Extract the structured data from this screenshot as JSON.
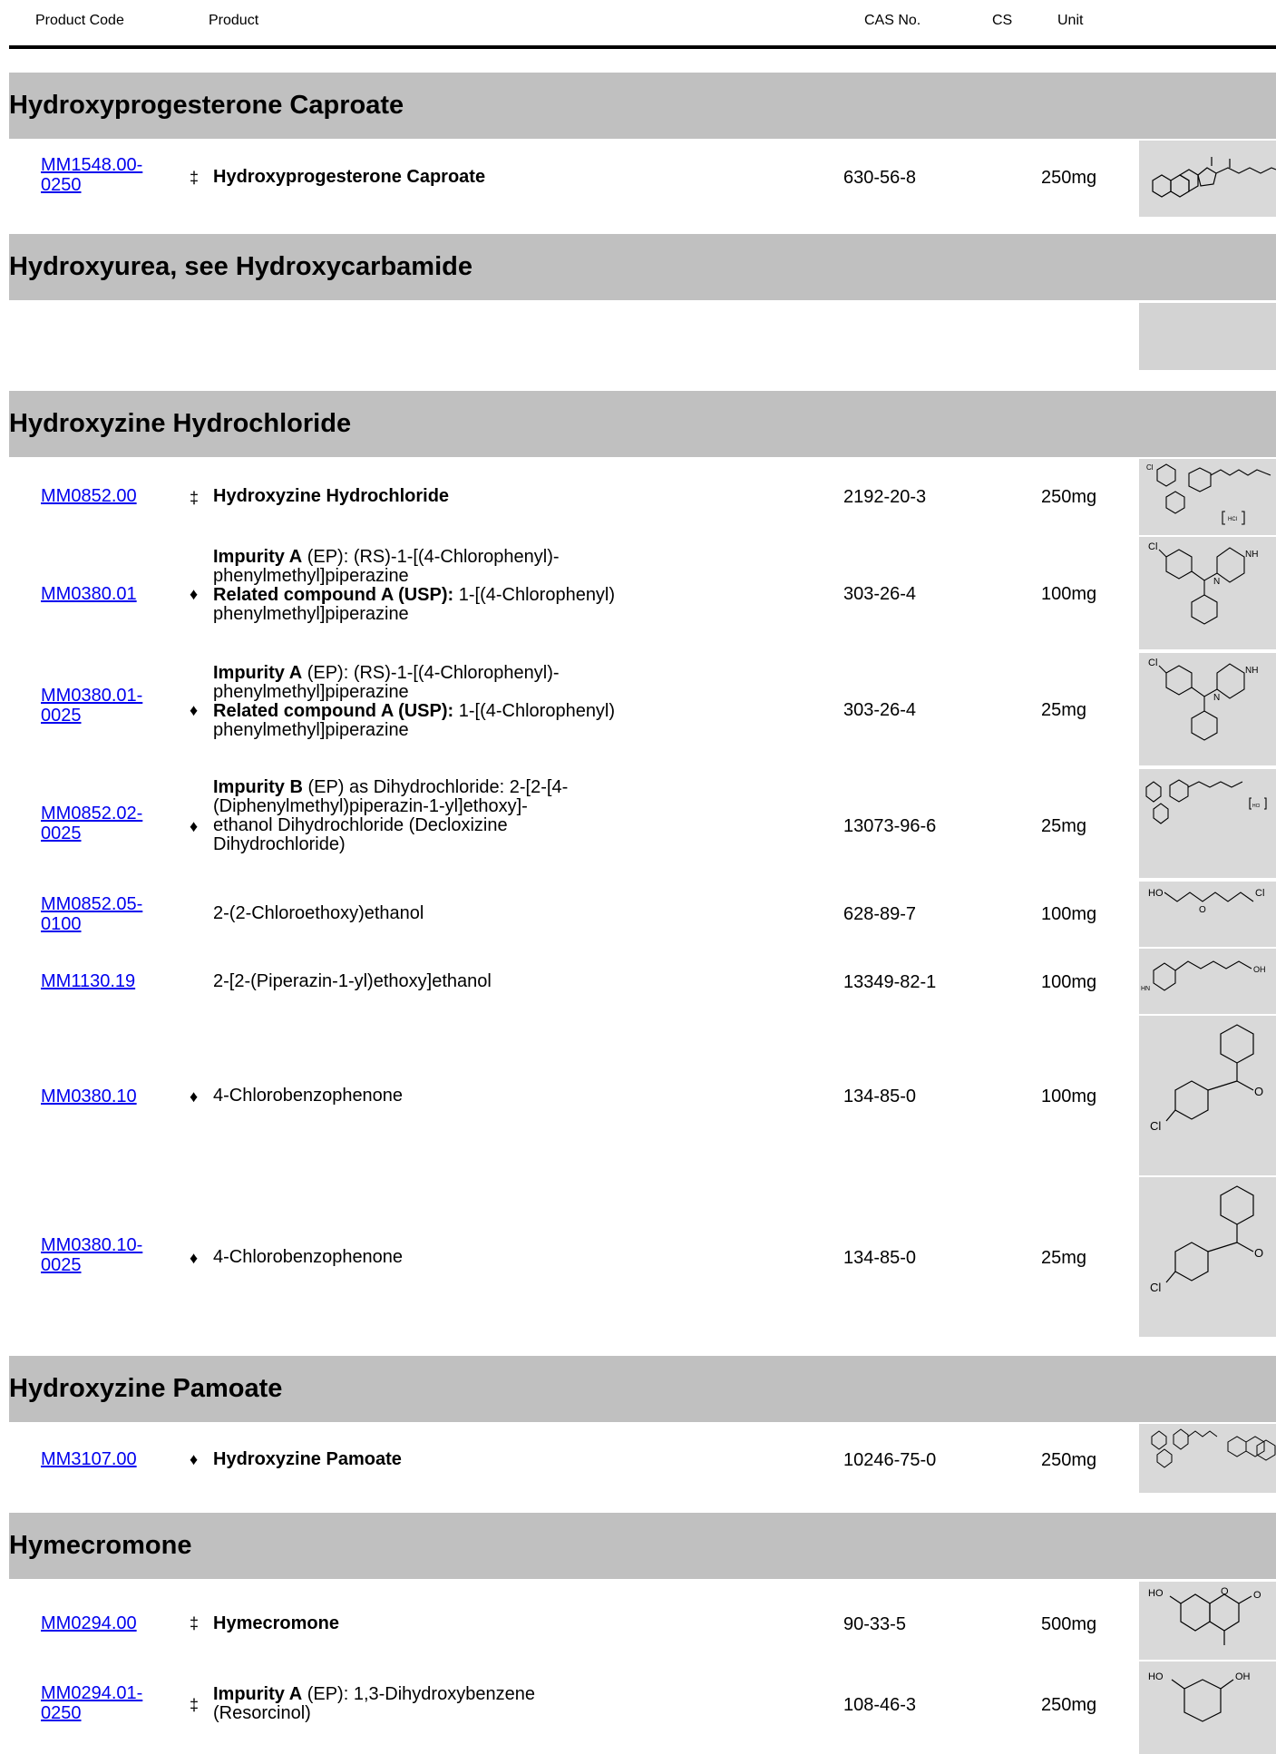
{
  "header": {
    "code": "Product Code",
    "product": "Product",
    "cas": "CAS No.",
    "cs": "CS",
    "unit": "Unit"
  },
  "sections": [
    {
      "title": "Hydroxyprogesterone Caproate",
      "rows": [
        {
          "code": "MM1548.00-0250",
          "sym": "‡",
          "name": "Hydroxyprogesterone Caproate",
          "cas": "630-56-8",
          "unit": "250mg"
        }
      ]
    },
    {
      "title": "Hydroxyurea, see Hydroxycarbamide",
      "rows": []
    },
    {
      "title": "Hydroxyzine Hydrochloride",
      "rows": [
        {
          "code": "MM0852.00",
          "sym": "‡",
          "name": "Hydroxyzine Hydrochloride",
          "cas": "2192-20-3",
          "unit": "250mg"
        },
        {
          "code": "MM0380.01",
          "sym": "♦",
          "l1b": "Impurity A",
          "l1": " (EP): (RS)-1-[(4-Chlorophenyl)-",
          "l2": "phenylmethyl]piperazine",
          "l3b": "Related compound A (USP):",
          "l3": " 1-[(4-Chlorophenyl)",
          "l4": "phenylmethyl]piperazine",
          "cas": "303-26-4",
          "unit": "100mg"
        },
        {
          "code": "MM0380.01-0025",
          "sym": "♦",
          "l1b": "Impurity A",
          "l1": " (EP): (RS)-1-[(4-Chlorophenyl)-",
          "l2": "phenylmethyl]piperazine",
          "l3b": "Related compound A (USP):",
          "l3": " 1-[(4-Chlorophenyl)",
          "l4": "phenylmethyl]piperazine",
          "cas": "303-26-4",
          "unit": "25mg"
        },
        {
          "code": "MM0852.02-0025",
          "sym": "♦",
          "l1b": "Impurity B",
          "l1": " (EP) as Dihydrochloride: 2-[2-[4-",
          "l2": "(Diphenylmethyl)piperazin-1-yl]ethoxy]-",
          "l3": "ethanol Dihydrochloride (Decloxizine",
          "l4": "Dihydrochloride)",
          "cas": "13073-96-6",
          "unit": "25mg"
        },
        {
          "code": "MM0852.05-0100",
          "sym": "",
          "name": "2-(2-Chloroethoxy)ethanol",
          "cas": "628-89-7",
          "unit": "100mg"
        },
        {
          "code": "MM1130.19",
          "sym": "",
          "name": "2-[2-(Piperazin-1-yl)ethoxy]ethanol",
          "cas": "13349-82-1",
          "unit": "100mg"
        },
        {
          "code": "MM0380.10",
          "sym": "♦",
          "name": "4-Chlorobenzophenone",
          "cas": "134-85-0",
          "unit": "100mg"
        },
        {
          "code": "MM0380.10-0025",
          "sym": "♦",
          "name": "4-Chlorobenzophenone",
          "cas": "134-85-0",
          "unit": "25mg"
        }
      ]
    },
    {
      "title": "Hydroxyzine Pamoate",
      "rows": [
        {
          "code": "MM3107.00",
          "sym": "♦",
          "name": "Hydroxyzine Pamoate",
          "cas": "10246-75-0",
          "unit": "250mg"
        }
      ]
    },
    {
      "title": "Hymecromone",
      "rows": [
        {
          "code": "MM0294.00",
          "sym": "‡",
          "name": "Hymecromone",
          "cas": "90-33-5",
          "unit": "500mg"
        },
        {
          "code": "MM0294.01-0250",
          "sym": "‡",
          "l1b": "Impurity A",
          "l1": " (EP): 1,3-Dihydroxybenzene",
          "l2": "(Resorcinol)",
          "cas": "108-46-3",
          "unit": "250mg"
        }
      ]
    }
  ],
  "structure_labels": {
    "cl": "Cl",
    "nh": "NH",
    "n": "N",
    "o": "O",
    "ho": "HO",
    "oh": "OH",
    "hcl": "HCl",
    "hn": "HN"
  }
}
